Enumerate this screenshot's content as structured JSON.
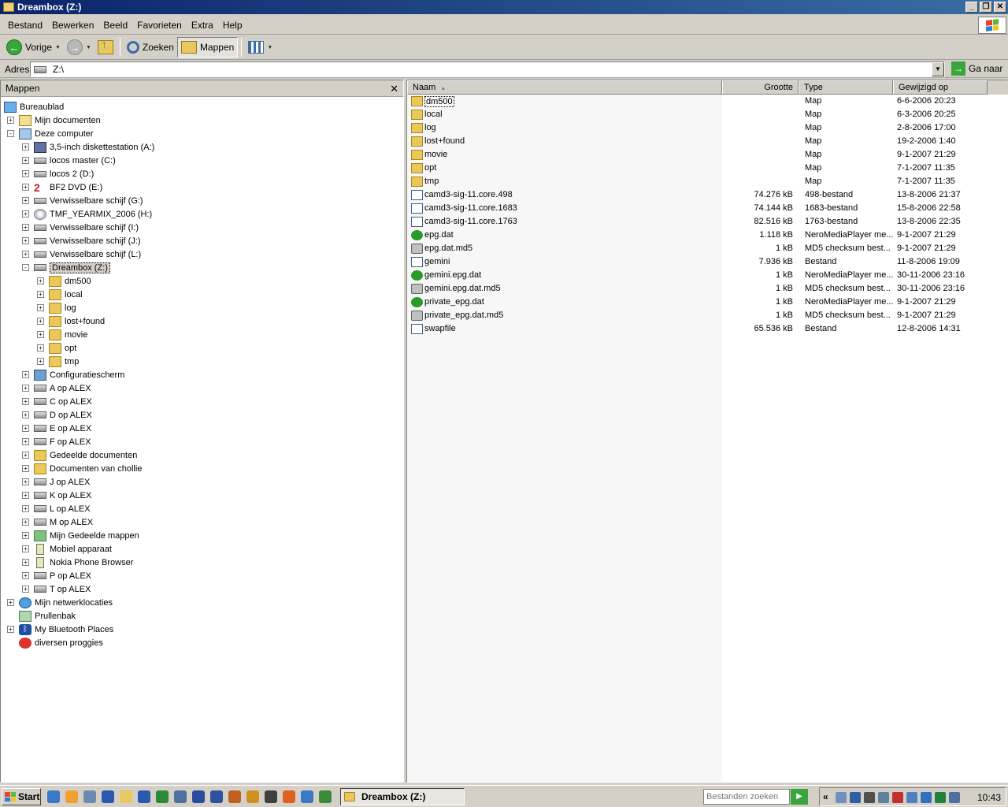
{
  "window": {
    "title": "Dreambox  (Z:)"
  },
  "menu": [
    "Bestand",
    "Bewerken",
    "Beeld",
    "Favorieten",
    "Extra",
    "Help"
  ],
  "toolbar": {
    "back_label": "Vorige",
    "search_label": "Zoeken",
    "folders_label": "Mappen"
  },
  "address": {
    "label": "Adres",
    "value": "Z:\\",
    "go_label": "Ga naar"
  },
  "folder_pane": {
    "title": "Mappen",
    "close_glyph": "✕",
    "tree": [
      {
        "label": "Bureaublad",
        "level": 0,
        "exp": "",
        "icon": "desktop"
      },
      {
        "label": "Mijn documenten",
        "level": 1,
        "exp": "+",
        "icon": "docs"
      },
      {
        "label": "Deze computer",
        "level": 1,
        "exp": "-",
        "icon": "computer"
      },
      {
        "label": "3,5-inch diskettestation (A:)",
        "level": 2,
        "exp": "+",
        "icon": "floppy"
      },
      {
        "label": "locos master (C:)",
        "level": 2,
        "exp": "+",
        "icon": "drive"
      },
      {
        "label": "locos 2 (D:)",
        "level": 2,
        "exp": "+",
        "icon": "drive"
      },
      {
        "label": "BF2 DVD (E:)",
        "level": 2,
        "exp": "+",
        "icon": "bf2"
      },
      {
        "label": "Verwisselbare schijf (G:)",
        "level": 2,
        "exp": "+",
        "icon": "drive"
      },
      {
        "label": "TMF_YEARMIX_2006 (H:)",
        "level": 2,
        "exp": "+",
        "icon": "dvd"
      },
      {
        "label": "Verwisselbare schijf (I:)",
        "level": 2,
        "exp": "+",
        "icon": "drive"
      },
      {
        "label": "Verwisselbare schijf (J:)",
        "level": 2,
        "exp": "+",
        "icon": "drive"
      },
      {
        "label": "Verwisselbare schijf (L:)",
        "level": 2,
        "exp": "+",
        "icon": "drive"
      },
      {
        "label": "Dreambox  (Z:)",
        "level": 2,
        "exp": "-",
        "icon": "netdrive",
        "selected": true
      },
      {
        "label": "dm500",
        "level": 3,
        "exp": "+",
        "icon": "folder"
      },
      {
        "label": "local",
        "level": 3,
        "exp": "+",
        "icon": "folder"
      },
      {
        "label": "log",
        "level": 3,
        "exp": "+",
        "icon": "folder"
      },
      {
        "label": "lost+found",
        "level": 3,
        "exp": "+",
        "icon": "folder"
      },
      {
        "label": "movie",
        "level": 3,
        "exp": "+",
        "icon": "folder"
      },
      {
        "label": "opt",
        "level": 3,
        "exp": "+",
        "icon": "folder"
      },
      {
        "label": "tmp",
        "level": 3,
        "exp": "+",
        "icon": "folder"
      },
      {
        "label": "Configuratiescherm",
        "level": 2,
        "exp": "+",
        "icon": "control"
      },
      {
        "label": "A op ALEX",
        "level": 2,
        "exp": "+",
        "icon": "netdrive"
      },
      {
        "label": "C op ALEX",
        "level": 2,
        "exp": "+",
        "icon": "netdrive"
      },
      {
        "label": "D op ALEX",
        "level": 2,
        "exp": "+",
        "icon": "netdrive"
      },
      {
        "label": "E op ALEX",
        "level": 2,
        "exp": "+",
        "icon": "netdrive"
      },
      {
        "label": "F op ALEX",
        "level": 2,
        "exp": "+",
        "icon": "netdrive"
      },
      {
        "label": "Gedeelde documenten",
        "level": 2,
        "exp": "+",
        "icon": "folder"
      },
      {
        "label": "Documenten van chollie",
        "level": 2,
        "exp": "+",
        "icon": "folder"
      },
      {
        "label": "J op ALEX",
        "level": 2,
        "exp": "+",
        "icon": "netdrive"
      },
      {
        "label": "K op ALEX",
        "level": 2,
        "exp": "+",
        "icon": "netdrive"
      },
      {
        "label": "L op ALEX",
        "level": 2,
        "exp": "+",
        "icon": "netdrive"
      },
      {
        "label": "M op ALEX",
        "level": 2,
        "exp": "+",
        "icon": "netdrive"
      },
      {
        "label": "Mijn Gedeelde mappen",
        "level": 2,
        "exp": "+",
        "icon": "sharedmap"
      },
      {
        "label": "Mobiel apparaat",
        "level": 2,
        "exp": "+",
        "icon": "phone"
      },
      {
        "label": "Nokia Phone Browser",
        "level": 2,
        "exp": "+",
        "icon": "phone"
      },
      {
        "label": "P op ALEX",
        "level": 2,
        "exp": "+",
        "icon": "netdrive"
      },
      {
        "label": "T op ALEX",
        "level": 2,
        "exp": "+",
        "icon": "netdrive"
      },
      {
        "label": "Mijn netwerklocaties",
        "level": 1,
        "exp": "+",
        "icon": "network"
      },
      {
        "label": "Prullenbak",
        "level": 1,
        "exp": "",
        "icon": "trash"
      },
      {
        "label": "My Bluetooth Places",
        "level": 1,
        "exp": "+",
        "icon": "bluetooth"
      },
      {
        "label": "diversen proggies",
        "level": 1,
        "exp": "",
        "icon": "forbidden"
      }
    ]
  },
  "file_list": {
    "columns": [
      "Naam",
      "Grootte",
      "Type",
      "Gewijzigd op"
    ],
    "rows": [
      {
        "name": "dm500",
        "size": "",
        "type": "Map",
        "date": "6-6-2006 20:23",
        "icon": "folder",
        "focused": true
      },
      {
        "name": "local",
        "size": "",
        "type": "Map",
        "date": "6-3-2006 20:25",
        "icon": "folder"
      },
      {
        "name": "log",
        "size": "",
        "type": "Map",
        "date": "2-8-2006 17:00",
        "icon": "folder"
      },
      {
        "name": "lost+found",
        "size": "",
        "type": "Map",
        "date": "19-2-2006 1:40",
        "icon": "folder"
      },
      {
        "name": "movie",
        "size": "",
        "type": "Map",
        "date": "9-1-2007 21:29",
        "icon": "folder"
      },
      {
        "name": "opt",
        "size": "",
        "type": "Map",
        "date": "7-1-2007 11:35",
        "icon": "folder"
      },
      {
        "name": "tmp",
        "size": "",
        "type": "Map",
        "date": "7-1-2007 11:35",
        "icon": "folder"
      },
      {
        "name": "camd3-sig-11.core.498",
        "size": "74.276 kB",
        "type": "498-bestand",
        "date": "13-8-2006 21:37",
        "icon": "core"
      },
      {
        "name": "camd3-sig-11.core.1683",
        "size": "74.144 kB",
        "type": "1683-bestand",
        "date": "15-8-2006 22:58",
        "icon": "core"
      },
      {
        "name": "camd3-sig-11.core.1763",
        "size": "82.516 kB",
        "type": "1763-bestand",
        "date": "13-8-2006 22:35",
        "icon": "core"
      },
      {
        "name": "epg.dat",
        "size": "1.118 kB",
        "type": "NeroMediaPlayer me...",
        "date": "9-1-2007 21:29",
        "icon": "nero"
      },
      {
        "name": "epg.dat.md5",
        "size": "1 kB",
        "type": "MD5 checksum best...",
        "date": "9-1-2007 21:29",
        "icon": "md5"
      },
      {
        "name": "gemini",
        "size": "7.936 kB",
        "type": "Bestand",
        "date": "11-8-2006 19:09",
        "icon": "core"
      },
      {
        "name": "gemini.epg.dat",
        "size": "1 kB",
        "type": "NeroMediaPlayer me...",
        "date": "30-11-2006 23:16",
        "icon": "nero"
      },
      {
        "name": "gemini.epg.dat.md5",
        "size": "1 kB",
        "type": "MD5 checksum best...",
        "date": "30-11-2006 23:16",
        "icon": "md5"
      },
      {
        "name": "private_epg.dat",
        "size": "1 kB",
        "type": "NeroMediaPlayer me...",
        "date": "9-1-2007 21:29",
        "icon": "nero"
      },
      {
        "name": "private_epg.dat.md5",
        "size": "1 kB",
        "type": "MD5 checksum best...",
        "date": "9-1-2007 21:29",
        "icon": "md5"
      },
      {
        "name": "swapfile",
        "size": "65.536 kB",
        "type": "Bestand",
        "date": "12-8-2006 14:31",
        "icon": "core"
      }
    ]
  },
  "taskbar": {
    "start_label": "Start",
    "task_label": "Dreambox  (Z:)",
    "search_placeholder": "Bestanden zoeken",
    "clock": "10:43",
    "chevron": "«"
  },
  "colors": {
    "titlebar": "#0a246a",
    "face": "#d4d0c8",
    "folder": "#ecc85a"
  }
}
